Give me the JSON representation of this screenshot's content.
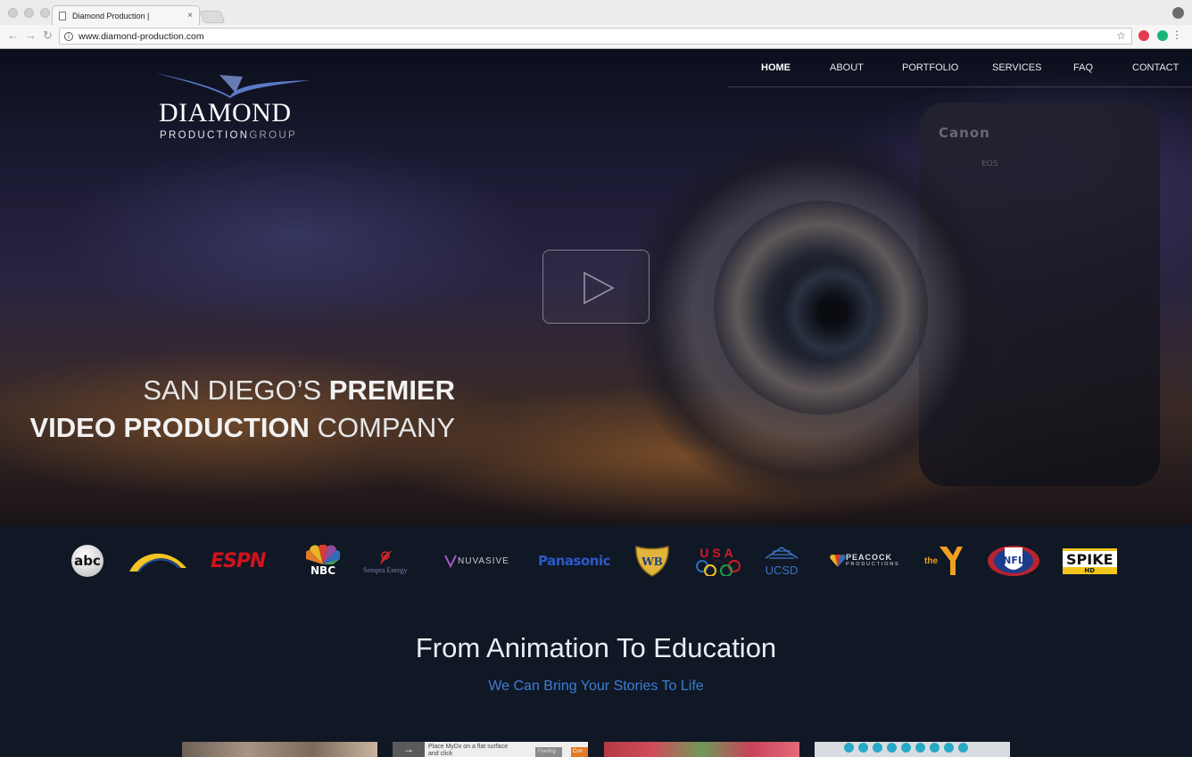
{
  "browser": {
    "tab_title": "Diamond Production |",
    "tab_close": "×",
    "url": "www.diamond-production.com",
    "back_icon": "←",
    "forward_icon": "→",
    "reload_icon": "↻",
    "info_icon": "i",
    "star_icon": "☆",
    "menu_icon": "⋮",
    "extensions": [
      {
        "name": "pinterest-icon",
        "color": "#e23b4f"
      },
      {
        "name": "grammarly-icon",
        "color": "#18b57a"
      }
    ]
  },
  "logo": {
    "main": "DIAMOND",
    "sub_bold": "PRODUCTION",
    "sub_light": "GROUP"
  },
  "nav": {
    "items": [
      "HOME",
      "ABOUT",
      "PORTFOLIO",
      "SERVICES",
      "FAQ",
      "CONTACT"
    ],
    "active": "HOME"
  },
  "hero": {
    "line1_thin": "SAN DIEGO’S ",
    "line1_bold": "PREMIER",
    "line2_bold": "VIDEO PRODUCTION",
    "line2_thin": " COMPANY",
    "camera_brand": "Canon",
    "camera_model": "EOS",
    "play_icon": "play-icon"
  },
  "clients": {
    "abc": "abc",
    "espn": "ESPN",
    "nbc": "NBC",
    "sempra": "Sempra Energy",
    "nuvasive": "NUVASIVE",
    "panasonic": "Panasonic",
    "usa": "USA",
    "ucsd": "UCSD",
    "peacock_main": "PEACOCK",
    "peacock_sub": "PRODUCTIONS",
    "ymca": "the",
    "nfl": "NFL",
    "spike_main": "SPIKE",
    "spike_sub": "HD"
  },
  "section": {
    "title": "From Animation To Education",
    "subtitle": "We Can Bring Your Stories To Life"
  },
  "thumbnails": {
    "t2_text": "Place MyDx on a flat surface and click",
    "t2_feel": "Feeling",
    "t2_btn": "Con"
  },
  "colors": {
    "accent_blue": "#3d7ed3",
    "background": "#101826",
    "espn_red": "#d1121c",
    "panasonic_blue": "#2d59c8"
  }
}
